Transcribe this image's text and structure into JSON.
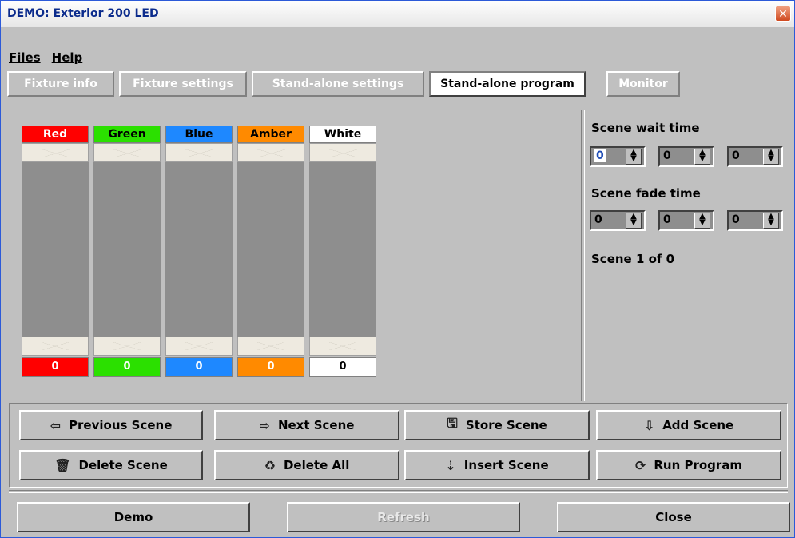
{
  "window": {
    "title": "DEMO: Exterior 200 LED",
    "close_symbol": "✕"
  },
  "menu": {
    "files": "Files",
    "help": "Help"
  },
  "tabs": [
    {
      "label": "Fixture info",
      "active": false
    },
    {
      "label": "Fixture settings",
      "active": false
    },
    {
      "label": "Stand-alone settings",
      "active": false
    },
    {
      "label": "Stand-alone program",
      "active": true
    },
    {
      "label": "Monitor",
      "active": false
    }
  ],
  "channels": [
    {
      "label": "Red",
      "value": "0",
      "color": "#ff0000",
      "text_color": "#ffffff"
    },
    {
      "label": "Green",
      "value": "0",
      "color": "#2be000",
      "text_color": "#000000"
    },
    {
      "label": "Blue",
      "value": "0",
      "color": "#1e88ff",
      "text_color": "#000000"
    },
    {
      "label": "Amber",
      "value": "0",
      "color": "#ff8a00",
      "text_color": "#000000"
    },
    {
      "label": "White",
      "value": "0",
      "color": "#ffffff",
      "text_color": "#000000"
    }
  ],
  "scene": {
    "wait_label": "Scene wait time",
    "wait_values": [
      "0",
      "0",
      "0"
    ],
    "fade_label": "Scene fade time",
    "fade_values": [
      "0",
      "0",
      "0"
    ],
    "status": "Scene 1 of 0"
  },
  "buttons": {
    "previous": "Previous Scene",
    "next": "Next Scene",
    "store": "Store Scene",
    "add": "Add Scene",
    "delete": "Delete Scene",
    "delete_all": "Delete All",
    "insert": "Insert Scene",
    "run": "Run Program"
  },
  "footer": {
    "demo": "Demo",
    "refresh": "Refresh",
    "close": "Close"
  }
}
